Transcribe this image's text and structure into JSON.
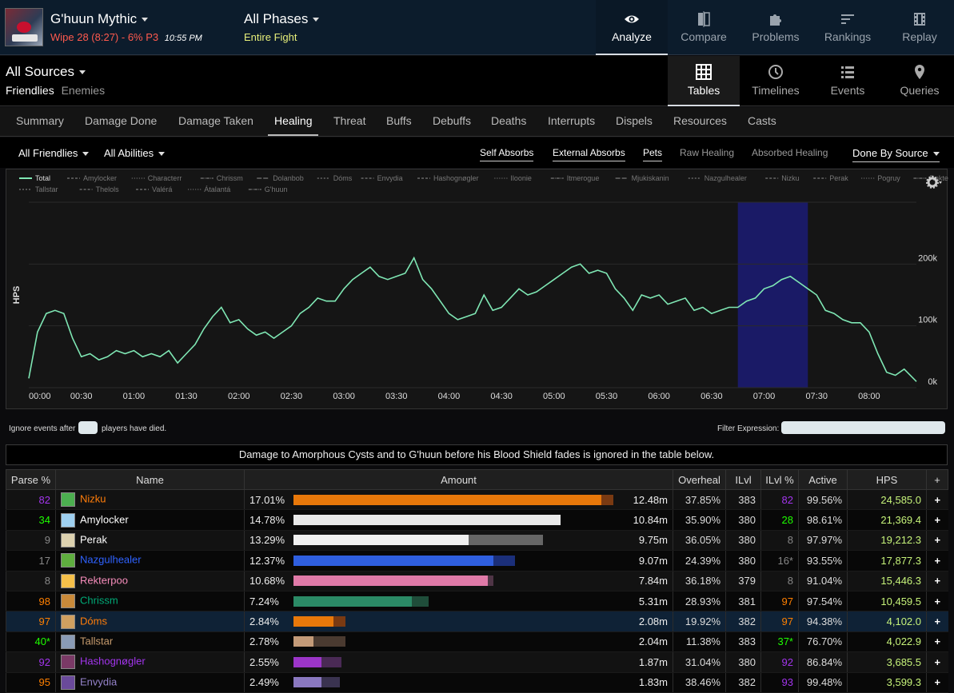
{
  "header": {
    "boss_name": "G'huun Mythic",
    "wipe_text": "Wipe 28 (8:27) - 6% P3",
    "time": "10:55 PM",
    "phase_title": "All Phases",
    "phase_sub": "Entire Fight",
    "nav": [
      {
        "label": "Analyze",
        "icon": "eye-icon"
      },
      {
        "label": "Compare",
        "icon": "compare-icon"
      },
      {
        "label": "Problems",
        "icon": "puzzle-icon"
      },
      {
        "label": "Rankings",
        "icon": "rankings-icon"
      },
      {
        "label": "Replay",
        "icon": "film-icon"
      }
    ]
  },
  "sources": {
    "title": "All Sources",
    "friendlies": "Friendlies",
    "enemies": "Enemies",
    "views": [
      {
        "label": "Tables",
        "icon": "grid-icon"
      },
      {
        "label": "Timelines",
        "icon": "clock-icon"
      },
      {
        "label": "Events",
        "icon": "list-icon"
      },
      {
        "label": "Queries",
        "icon": "pin-icon"
      }
    ]
  },
  "tabs": [
    "Summary",
    "Damage Done",
    "Damage Taken",
    "Healing",
    "Threat",
    "Buffs",
    "Debuffs",
    "Deaths",
    "Interrupts",
    "Dispels",
    "Resources",
    "Casts"
  ],
  "filters": {
    "friendlies": "All Friendlies",
    "abilities": "All Abilities",
    "self_absorbs": "Self Absorbs",
    "external_absorbs": "External Absorbs",
    "pets": "Pets",
    "raw_healing": "Raw Healing",
    "absorbed_healing": "Absorbed Healing",
    "done_by": "Done By Source"
  },
  "chart_data": {
    "type": "line",
    "ylabel": "HPS",
    "yticks": [
      "0k",
      "100k",
      "200k"
    ],
    "ylim": [
      0,
      300000
    ],
    "xticks": [
      "00:00",
      "00:30",
      "01:00",
      "01:30",
      "02:00",
      "02:30",
      "03:00",
      "03:30",
      "04:00",
      "04:30",
      "05:00",
      "05:30",
      "06:00",
      "06:30",
      "07:00",
      "07:30",
      "08:00"
    ],
    "xlim_seconds": [
      0,
      507
    ],
    "highlight_range_seconds": [
      405,
      445
    ],
    "legend": [
      "Total",
      "Amylocker",
      "Characterr",
      "Chrissm",
      "Dolanbob",
      "Dóms",
      "Envydia",
      "Hashognøgler",
      "Iloonie",
      "Itmerogue",
      "Mjukiskanin",
      "Nazgulhealer",
      "Nizku",
      "Perak",
      "Pogruy",
      "Rekterpoo",
      "Skadi",
      "Tallstar",
      "Thelols",
      "Valérá",
      "Átalantá",
      "G'huun"
    ],
    "series": [
      {
        "name": "Total",
        "color": "#7fe7b4",
        "x": [
          0,
          5,
          10,
          15,
          20,
          25,
          30,
          35,
          40,
          45,
          50,
          55,
          60,
          65,
          70,
          75,
          80,
          85,
          90,
          95,
          100,
          105,
          110,
          115,
          120,
          125,
          130,
          135,
          140,
          145,
          150,
          155,
          160,
          165,
          170,
          175,
          180,
          185,
          190,
          195,
          200,
          205,
          210,
          215,
          220,
          225,
          230,
          235,
          240,
          245,
          250,
          255,
          260,
          265,
          270,
          275,
          280,
          285,
          290,
          295,
          300,
          305,
          310,
          315,
          320,
          325,
          330,
          335,
          340,
          345,
          350,
          355,
          360,
          365,
          370,
          375,
          380,
          385,
          390,
          395,
          400,
          405,
          410,
          415,
          420,
          425,
          430,
          435,
          440,
          445,
          450,
          455,
          460,
          465,
          470,
          475,
          480,
          485,
          490,
          495,
          500,
          507
        ],
        "values": [
          15000,
          90000,
          120000,
          125000,
          120000,
          80000,
          50000,
          55000,
          45000,
          50000,
          60000,
          55000,
          60000,
          50000,
          55000,
          50000,
          60000,
          40000,
          55000,
          70000,
          95000,
          115000,
          130000,
          105000,
          110000,
          95000,
          85000,
          90000,
          80000,
          90000,
          100000,
          120000,
          130000,
          145000,
          140000,
          140000,
          160000,
          175000,
          185000,
          195000,
          180000,
          175000,
          180000,
          185000,
          210000,
          175000,
          160000,
          140000,
          120000,
          110000,
          115000,
          120000,
          150000,
          125000,
          130000,
          145000,
          160000,
          150000,
          155000,
          165000,
          175000,
          185000,
          195000,
          200000,
          185000,
          190000,
          185000,
          160000,
          145000,
          125000,
          150000,
          145000,
          150000,
          135000,
          140000,
          145000,
          125000,
          130000,
          120000,
          125000,
          130000,
          130000,
          140000,
          145000,
          160000,
          165000,
          175000,
          180000,
          170000,
          160000,
          150000,
          125000,
          120000,
          110000,
          105000,
          105000,
          90000,
          55000,
          25000,
          20000,
          30000,
          10000
        ]
      }
    ]
  },
  "controls": {
    "ignore_prefix": "Ignore events after",
    "ignore_suffix": "players have died.",
    "filter_label": "Filter Expression:"
  },
  "banner": "Damage to Amorphous Cysts and to G'huun before his Blood Shield fades is ignored in the table below.",
  "table": {
    "headers": [
      "Parse %",
      "Name",
      "Amount",
      "Overheal",
      "ILvl",
      "ILvl %",
      "Active",
      "HPS",
      "+"
    ],
    "rows": [
      {
        "parse": "82",
        "parse_color": "#a335ee",
        "name": "Nizku",
        "name_color": "#ff7d0a",
        "icon_color": "#4caf50",
        "pct": "17.01%",
        "bar_frac": 1.0,
        "over_frac": 0.04,
        "bar_color": "#e8780a",
        "amount": "12.48m",
        "overheal": "37.85%",
        "ilvl": "383",
        "ilvl_pct": "82",
        "ilvl_pct_color": "#a335ee",
        "active": "99.56%",
        "hps": "24,585.0"
      },
      {
        "parse": "34",
        "parse_color": "#1eff00",
        "name": "Amylocker",
        "name_color": "#ffffff",
        "icon_color": "#9fd0f0",
        "pct": "14.78%",
        "bar_frac": 0.868,
        "over_frac": 0.0,
        "bar_color": "#e8e8e8",
        "amount": "10.84m",
        "overheal": "35.90%",
        "ilvl": "380",
        "ilvl_pct": "28",
        "ilvl_pct_color": "#1eff00",
        "active": "98.61%",
        "hps": "21,369.4"
      },
      {
        "parse": "9",
        "parse_color": "#888888",
        "name": "Perak",
        "name_color": "#ffffff",
        "icon_color": "#ddd2b0",
        "pct": "13.29%",
        "bar_frac": 0.57,
        "over_frac": 0.24,
        "bar_color": "#f0f0f0",
        "amount": "9.75m",
        "overheal": "36.05%",
        "ilvl": "380",
        "ilvl_pct": "8",
        "ilvl_pct_color": "#888888",
        "active": "97.97%",
        "hps": "19,212.3"
      },
      {
        "parse": "17",
        "parse_color": "#888888",
        "name": "Nazgulhealer",
        "name_color": "#2f62ff",
        "icon_color": "#5fae3f",
        "pct": "12.37%",
        "bar_frac": 0.65,
        "over_frac": 0.07,
        "bar_color": "#2f5fe0",
        "amount": "9.07m",
        "overheal": "24.39%",
        "ilvl": "380",
        "ilvl_pct": "16*",
        "ilvl_pct_color": "#888888",
        "active": "93.55%",
        "hps": "17,877.3"
      },
      {
        "parse": "8",
        "parse_color": "#888888",
        "name": "Rekterpoo",
        "name_color": "#f58cba",
        "icon_color": "#f5c04a",
        "pct": "10.68%",
        "bar_frac": 0.63,
        "over_frac": 0.02,
        "bar_color": "#e07aa8",
        "amount": "7.84m",
        "overheal": "36.18%",
        "ilvl": "379",
        "ilvl_pct": "8",
        "ilvl_pct_color": "#888888",
        "active": "91.04%",
        "hps": "15,446.3"
      },
      {
        "parse": "98",
        "parse_color": "#ff8000",
        "name": "Chrissm",
        "name_color": "#00aa77",
        "icon_color": "#c98a3a",
        "pct": "7.24%",
        "bar_frac": 0.385,
        "over_frac": 0.055,
        "bar_color": "#2b8a66",
        "amount": "5.31m",
        "overheal": "28.93%",
        "ilvl": "381",
        "ilvl_pct": "97",
        "ilvl_pct_color": "#ff8000",
        "active": "97.54%",
        "hps": "10,459.5"
      },
      {
        "parse": "97",
        "parse_color": "#ff8000",
        "name": "Dóms",
        "name_color": "#ff7d0a",
        "icon_color": "#d0a060",
        "pct": "2.84%",
        "bar_frac": 0.13,
        "over_frac": 0.04,
        "bar_color": "#e8780a",
        "amount": "2.08m",
        "overheal": "19.92%",
        "ilvl": "382",
        "ilvl_pct": "97",
        "ilvl_pct_color": "#ff8000",
        "active": "94.38%",
        "hps": "4,102.0"
      },
      {
        "parse": "40*",
        "parse_color": "#1eff00",
        "name": "Tallstar",
        "name_color": "#c79c6e",
        "icon_color": "#8a9bb5",
        "pct": "2.78%",
        "bar_frac": 0.064,
        "over_frac": 0.105,
        "bar_color": "#c39a78",
        "amount": "2.04m",
        "overheal": "11.38%",
        "ilvl": "383",
        "ilvl_pct": "37*",
        "ilvl_pct_color": "#1eff00",
        "active": "76.70%",
        "hps": "4,022.9"
      },
      {
        "parse": "92",
        "parse_color": "#a335ee",
        "name": "Hashognøgler",
        "name_color": "#a335ee",
        "icon_color": "#7a3a66",
        "pct": "2.55%",
        "bar_frac": 0.09,
        "over_frac": 0.065,
        "bar_color": "#9b35c8",
        "amount": "1.87m",
        "overheal": "31.04%",
        "ilvl": "380",
        "ilvl_pct": "92",
        "ilvl_pct_color": "#a335ee",
        "active": "86.84%",
        "hps": "3,685.5"
      },
      {
        "parse": "95",
        "parse_color": "#ff8000",
        "name": "Envydia",
        "name_color": "#9482c9",
        "icon_color": "#6a4a9a",
        "pct": "2.49%",
        "bar_frac": 0.09,
        "over_frac": 0.06,
        "bar_color": "#8a78c0",
        "amount": "1.83m",
        "overheal": "38.46%",
        "ilvl": "382",
        "ilvl_pct": "93",
        "ilvl_pct_color": "#a335ee",
        "active": "99.48%",
        "hps": "3,599.3"
      }
    ]
  }
}
